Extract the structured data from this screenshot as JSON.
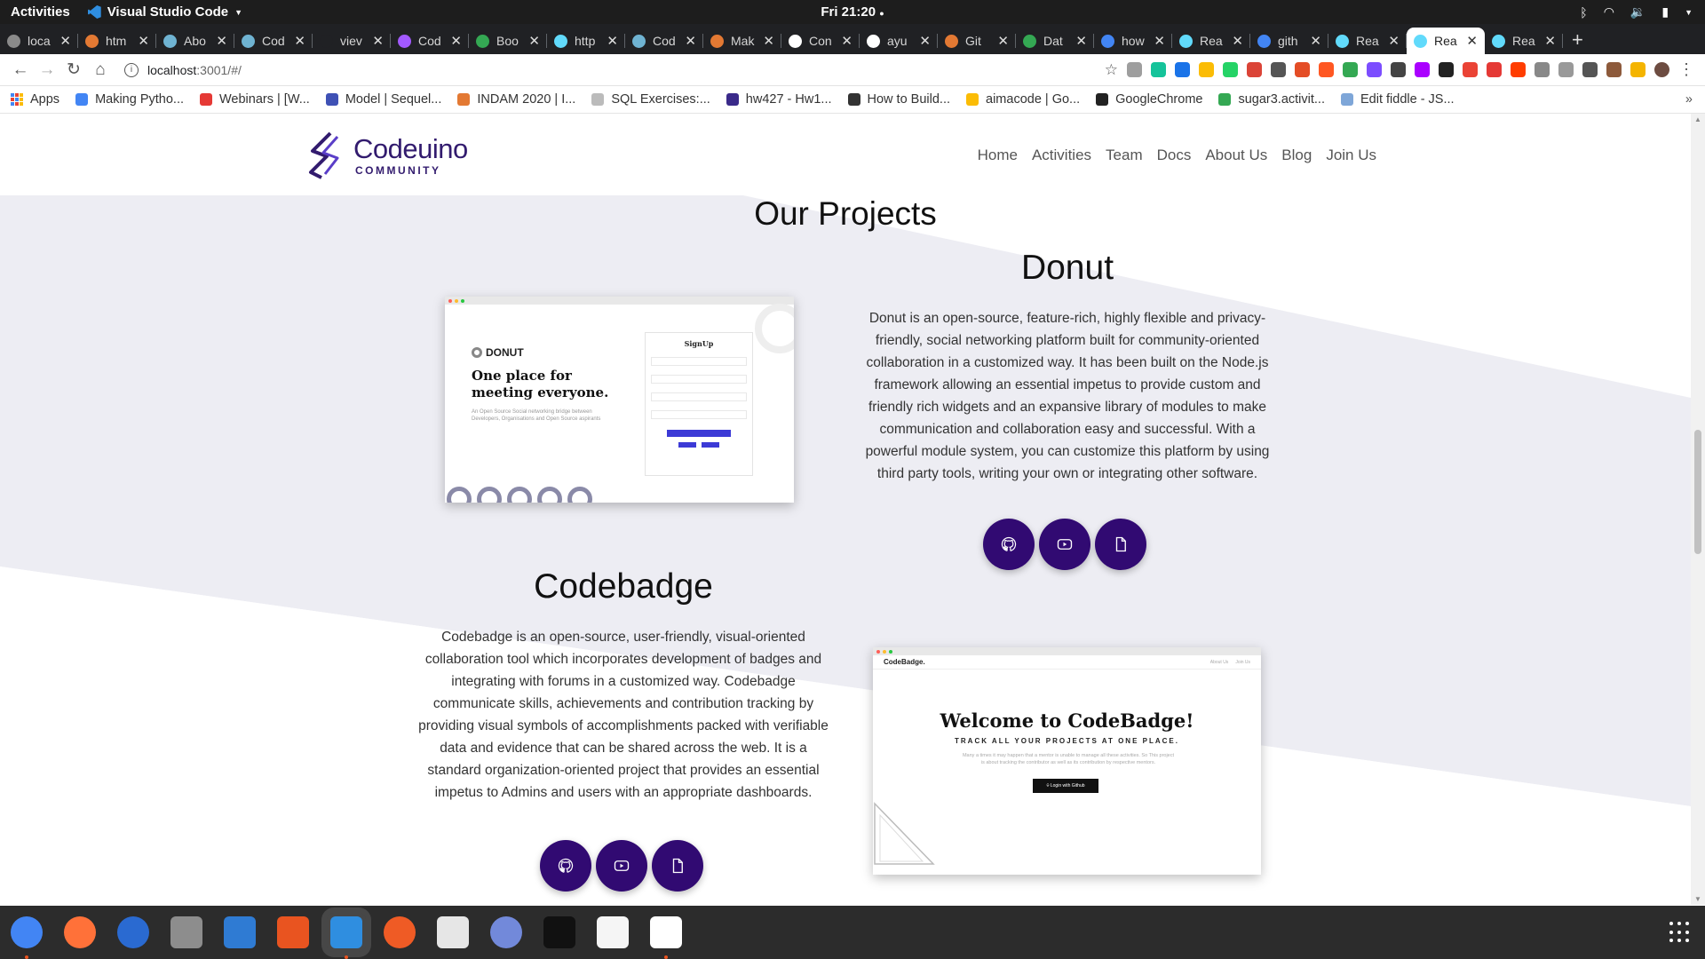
{
  "system": {
    "activities": "Activities",
    "app_menu": "Visual Studio Code",
    "clock": "Fri 21:20"
  },
  "tabs": [
    {
      "title": "loca",
      "color": "#8a8a8a"
    },
    {
      "title": "htm",
      "color": "#e37933"
    },
    {
      "title": "Abo",
      "color": "#6fb3d2"
    },
    {
      "title": "Cod",
      "color": "#6fb3d2"
    },
    {
      "title": "viev",
      "color": "#202124"
    },
    {
      "title": "Cod",
      "color": "#a259ff"
    },
    {
      "title": "Boo",
      "color": "#34a853"
    },
    {
      "title": "http",
      "color": "#61dafb"
    },
    {
      "title": "Cod",
      "color": "#6fb3d2"
    },
    {
      "title": "Mak",
      "color": "#e37933"
    },
    {
      "title": "Con",
      "color": "#ffffff"
    },
    {
      "title": "ayu",
      "color": "#ffffff"
    },
    {
      "title": "Git",
      "color": "#e37933"
    },
    {
      "title": "Dat",
      "color": "#34a853"
    },
    {
      "title": "how",
      "color": "#4285f4"
    },
    {
      "title": "Rea",
      "color": "#61dafb"
    },
    {
      "title": "gith",
      "color": "#4285f4"
    },
    {
      "title": "Rea",
      "color": "#61dafb"
    },
    {
      "title": "Rea",
      "color": "#61dafb",
      "active": true
    },
    {
      "title": "Rea",
      "color": "#61dafb"
    }
  ],
  "address": {
    "host": "localhost",
    "path": ":3001/#/"
  },
  "extension_colors": [
    "#9e9e9e",
    "#15c39a",
    "#1a73e8",
    "#fbbc05",
    "#25d366",
    "#db4437",
    "#555555",
    "#e44d26",
    "#ff5722",
    "#34a853",
    "#7c4dff",
    "#444444",
    "#aa00ff",
    "#222222",
    "#ea4335",
    "#e53935",
    "#ff3d00",
    "#888888",
    "#999999",
    "#555555",
    "#8d5a3b",
    "#f4b400"
  ],
  "bookmarks": [
    {
      "label": "Apps",
      "type": "apps"
    },
    {
      "label": "Making Pytho...",
      "color": "#4285f4"
    },
    {
      "label": "Webinars | [W...",
      "color": "#e53935"
    },
    {
      "label": "Model | Sequel...",
      "color": "#3f51b5"
    },
    {
      "label": "INDAM 2020 | I...",
      "color": "#e37933"
    },
    {
      "label": "SQL Exercises:...",
      "color": "#bbbbbb"
    },
    {
      "label": "hw427 - Hw1...",
      "color": "#3a2a8a"
    },
    {
      "label": "How to Build...",
      "color": "#333333"
    },
    {
      "label": "aimacode | Go...",
      "color": "#fbbc05"
    },
    {
      "label": "GoogleChrome",
      "color": "#222222"
    },
    {
      "label": "sugar3.activit...",
      "color": "#34a853"
    },
    {
      "label": "Edit fiddle - JS...",
      "color": "#7ea6d8"
    }
  ],
  "site": {
    "brand": "Codeuino",
    "brand_sub": "COMMUNITY",
    "brand_color": "#321b6e",
    "nav": [
      "Home",
      "Activities",
      "Team",
      "Docs",
      "About Us",
      "Blog",
      "Join Us"
    ],
    "section_title": "Our Projects",
    "accent": "#310a72",
    "projects": [
      {
        "name": "Donut",
        "description": "Donut is an open-source, feature-rich, highly flexible and privacy-friendly, social networking platform built for community-oriented collaboration in a customized way. It has been built on the Node.js framework allowing an essential impetus to provide custom and friendly rich widgets and an expansive library of modules to make communication and collaboration easy and successful. With a powerful module system, you can customize this platform by using third party tools, writing your own or integrating other software.",
        "preview": {
          "logo": "DONUT",
          "headline": "One place for meeting everyone.",
          "subtext": "An Open Source Social networking bridge between Developers, Organisations and Open Source aspirants",
          "form_title": "SignUp"
        }
      },
      {
        "name": "Codebadge",
        "description": "Codebadge is an open-source, user-friendly, visual-oriented collaboration tool which incorporates development of badges and integrating with forums in a customized way. Codebadge communicate skills, achievements and contribution tracking by providing visual symbols of accomplishments packed with verifiable data and evidence that can be shared across the web. It is a standard organization-oriented project that provides an essential impetus to Admins and users with an appropriate dashboards.",
        "preview": {
          "brand": "CodeBadge.",
          "links": [
            "About Us",
            "Join Us"
          ],
          "headline": "Welcome to CodeBadge!",
          "tagline": "TRACK ALL YOUR PROJECTS AT ONE PLACE.",
          "para": "Many a times it may happen that a mentor is unable to manage all these activities. So This project is about tracking the contributor as well as its contribution by respective mentors.",
          "login": "Login with Github"
        }
      }
    ]
  },
  "dock": [
    {
      "name": "chrome",
      "color": "#4285f4",
      "running": true
    },
    {
      "name": "firefox",
      "color": "#ff7139"
    },
    {
      "name": "thunderbird",
      "color": "#2a6ad1"
    },
    {
      "name": "files",
      "color": "#8d8d8d"
    },
    {
      "name": "libreoffice-writer",
      "color": "#2f7bd3"
    },
    {
      "name": "software-center",
      "color": "#e95420"
    },
    {
      "name": "vscode",
      "color": "#2f8ee0",
      "active": true,
      "running": true
    },
    {
      "name": "postman",
      "color": "#ef5b25"
    },
    {
      "name": "amazon",
      "color": "#e6e6e6"
    },
    {
      "name": "discord",
      "color": "#7289da"
    },
    {
      "name": "inkscape",
      "color": "#111111"
    },
    {
      "name": "text-editor",
      "color": "#f5f5f5"
    },
    {
      "name": "document",
      "color": "#ffffff",
      "running": true
    }
  ]
}
